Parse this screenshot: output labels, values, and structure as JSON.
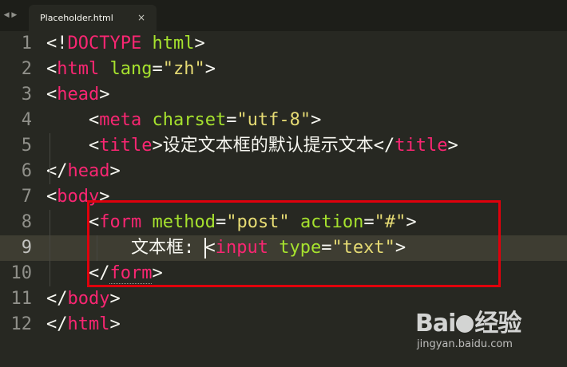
{
  "tab": {
    "title": "Placeholder.html",
    "close_glyph": "×",
    "nav_glyph": "◀ ▶"
  },
  "editor": {
    "active_line": 9,
    "lines": [
      {
        "n": "1",
        "tokens": [
          [
            "p",
            "<!"
          ],
          [
            "t",
            "DOCTYPE"
          ],
          [
            "sp",
            " "
          ],
          [
            "a",
            "html"
          ],
          [
            "p",
            ">"
          ]
        ]
      },
      {
        "n": "2",
        "tokens": [
          [
            "p",
            "<"
          ],
          [
            "t",
            "html"
          ],
          [
            "sp",
            " "
          ],
          [
            "a",
            "lang"
          ],
          [
            "p",
            "="
          ],
          [
            "s",
            "\"zh\""
          ],
          [
            "p",
            ">"
          ]
        ]
      },
      {
        "n": "3",
        "tokens": [
          [
            "p",
            "<"
          ],
          [
            "t",
            "head"
          ],
          [
            "p",
            ">"
          ]
        ]
      },
      {
        "n": "4",
        "tokens": [
          [
            "sp",
            "    "
          ],
          [
            "p",
            "<"
          ],
          [
            "t",
            "meta"
          ],
          [
            "sp",
            " "
          ],
          [
            "a",
            "charset"
          ],
          [
            "p",
            "="
          ],
          [
            "s",
            "\"utf-8\""
          ],
          [
            "p",
            ">"
          ]
        ]
      },
      {
        "n": "5",
        "tokens": [
          [
            "sp",
            "    "
          ],
          [
            "p",
            "<"
          ],
          [
            "t",
            "title"
          ],
          [
            "p",
            ">设定文本框的默认提示文本</"
          ],
          [
            "t",
            "title"
          ],
          [
            "p",
            ">"
          ]
        ]
      },
      {
        "n": "6",
        "tokens": [
          [
            "p",
            "</"
          ],
          [
            "t",
            "head"
          ],
          [
            "p",
            ">"
          ]
        ]
      },
      {
        "n": "7",
        "tokens": [
          [
            "p",
            "<"
          ],
          [
            "t",
            "body"
          ],
          [
            "p",
            ">"
          ]
        ]
      },
      {
        "n": "8",
        "tokens": [
          [
            "sp",
            "    "
          ],
          [
            "p",
            "<"
          ],
          [
            "t",
            "form"
          ],
          [
            "sp",
            " "
          ],
          [
            "a",
            "method"
          ],
          [
            "p",
            "="
          ],
          [
            "s",
            "\"post\""
          ],
          [
            "sp",
            " "
          ],
          [
            "a",
            "action"
          ],
          [
            "p",
            "="
          ],
          [
            "s",
            "\"#\""
          ],
          [
            "p",
            ">"
          ]
        ]
      },
      {
        "n": "9",
        "tokens": [
          [
            "sp",
            "        "
          ],
          [
            "p",
            "文本框: "
          ],
          [
            "cursor",
            ""
          ],
          [
            "p",
            "<"
          ],
          [
            "t",
            "input"
          ],
          [
            "sp",
            " "
          ],
          [
            "a",
            "type"
          ],
          [
            "p",
            "="
          ],
          [
            "s",
            "\"text\""
          ],
          [
            "p",
            ">"
          ]
        ]
      },
      {
        "n": "10",
        "tokens": [
          [
            "sp",
            "    "
          ],
          [
            "p",
            "</"
          ],
          [
            "tu",
            "form"
          ],
          [
            "p",
            ">"
          ]
        ]
      },
      {
        "n": "11",
        "tokens": [
          [
            "p",
            "</"
          ],
          [
            "t",
            "body"
          ],
          [
            "p",
            ">"
          ]
        ]
      },
      {
        "n": "12",
        "tokens": [
          [
            "p",
            "</"
          ],
          [
            "t",
            "html"
          ],
          [
            "p",
            ">"
          ]
        ]
      }
    ]
  },
  "colors": {
    "background": "#272822",
    "tag": "#f92672",
    "attribute": "#a6e22e",
    "string": "#e6db74",
    "highlight_box": "#e0000c"
  },
  "watermark": {
    "logo_left": "Bai",
    "logo_right": "经验",
    "site": "jingyan.baidu.com"
  }
}
